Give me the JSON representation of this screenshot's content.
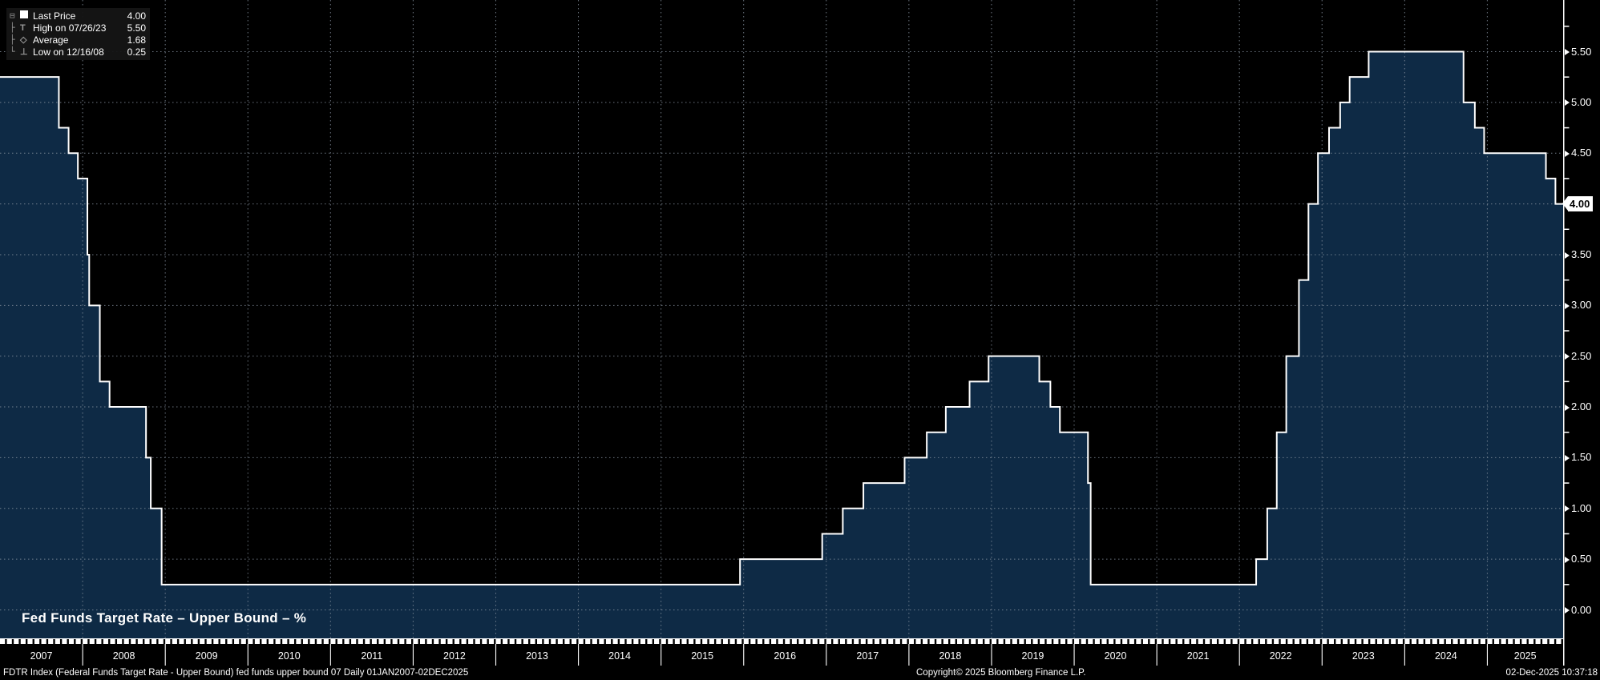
{
  "title": "Fed Funds Target Rate – Upper Bound – %",
  "colors": {
    "background": "#000000",
    "area_fill": "#0e2a45",
    "step_line": "#ffffff",
    "grid": "#8893a0",
    "axis": "#ffffff",
    "text": "#ffffff",
    "last_price_bg": "#ffffff",
    "last_price_text": "#000000",
    "legend_bg": "#151515",
    "legend_tree": "#8f8f8f"
  },
  "legend": {
    "expand_glyph": "⊟",
    "rows": [
      {
        "tree": "",
        "icon": "last-price-swatch",
        "glyph": "",
        "label": "Last Price",
        "value": "4.00"
      },
      {
        "tree": "├",
        "icon": "high-whisker",
        "glyph": "T",
        "label": "High on 07/26/23",
        "value": "5.50"
      },
      {
        "tree": "├",
        "icon": "average-marker",
        "glyph": "◇",
        "label": "Average",
        "value": "1.68"
      },
      {
        "tree": "└",
        "icon": "low-whisker",
        "glyph": "⊥",
        "label": "Low on 12/16/08",
        "value": "0.25"
      }
    ]
  },
  "y_axis": {
    "ticks": [
      "0.00",
      "0.50",
      "1.00",
      "1.50",
      "2.00",
      "2.50",
      "3.00",
      "3.50",
      "4.00",
      "4.50",
      "5.00",
      "5.50"
    ],
    "minor_step": 0.25,
    "range": [
      0,
      5.5
    ],
    "last_price": "4.00"
  },
  "x_axis": {
    "years": [
      "2007",
      "2008",
      "2009",
      "2010",
      "2011",
      "2012",
      "2013",
      "2014",
      "2015",
      "2016",
      "2017",
      "2018",
      "2019",
      "2020",
      "2021",
      "2022",
      "2023",
      "2024",
      "2025"
    ],
    "start_date": "2007-01-01",
    "end_date": "2025-12-02"
  },
  "status_bar": {
    "left": "FDTR Index (Federal Funds Target Rate - Upper Bound) fed funds upper bound 07 Daily 01JAN2007-02DEC2025",
    "copyright": "Copyright© 2025 Bloomberg Finance L.P.",
    "timestamp": "02-Dec-2025 10:37:18"
  },
  "chart_data": {
    "type": "area",
    "step": true,
    "title": "Fed Funds Target Rate – Upper Bound – %",
    "xlabel": "",
    "ylabel": "%",
    "ylim": [
      0,
      5.5
    ],
    "grid": "dotted both axes",
    "legend_position": "top-left",
    "last_price": 4.0,
    "high": {
      "date": "2023-07-26",
      "value": 5.5
    },
    "low": {
      "date": "2008-12-16",
      "value": 0.25
    },
    "average": 1.68,
    "series": [
      {
        "name": "FDTR Index",
        "points": [
          [
            "2007-01-01",
            5.25
          ],
          [
            "2007-09-18",
            4.75
          ],
          [
            "2007-10-31",
            4.5
          ],
          [
            "2007-12-11",
            4.25
          ],
          [
            "2008-01-22",
            3.5
          ],
          [
            "2008-01-30",
            3.0
          ],
          [
            "2008-03-18",
            2.25
          ],
          [
            "2008-04-30",
            2.0
          ],
          [
            "2008-10-08",
            1.5
          ],
          [
            "2008-10-29",
            1.0
          ],
          [
            "2008-12-16",
            0.25
          ],
          [
            "2015-12-16",
            0.5
          ],
          [
            "2016-12-14",
            0.75
          ],
          [
            "2017-03-15",
            1.0
          ],
          [
            "2017-06-14",
            1.25
          ],
          [
            "2017-12-13",
            1.5
          ],
          [
            "2018-03-21",
            1.75
          ],
          [
            "2018-06-13",
            2.0
          ],
          [
            "2018-09-26",
            2.25
          ],
          [
            "2018-12-19",
            2.5
          ],
          [
            "2019-07-31",
            2.25
          ],
          [
            "2019-09-18",
            2.0
          ],
          [
            "2019-10-30",
            1.75
          ],
          [
            "2020-03-03",
            1.25
          ],
          [
            "2020-03-15",
            0.25
          ],
          [
            "2022-03-16",
            0.5
          ],
          [
            "2022-05-04",
            1.0
          ],
          [
            "2022-06-15",
            1.75
          ],
          [
            "2022-07-27",
            2.5
          ],
          [
            "2022-09-21",
            3.25
          ],
          [
            "2022-11-02",
            4.0
          ],
          [
            "2022-12-14",
            4.5
          ],
          [
            "2023-02-01",
            4.75
          ],
          [
            "2023-03-22",
            5.0
          ],
          [
            "2023-05-03",
            5.25
          ],
          [
            "2023-07-26",
            5.5
          ],
          [
            "2024-09-18",
            5.0
          ],
          [
            "2024-11-07",
            4.75
          ],
          [
            "2024-12-18",
            4.5
          ],
          [
            "2025-09-17",
            4.25
          ],
          [
            "2025-10-29",
            4.0
          ]
        ]
      }
    ]
  }
}
